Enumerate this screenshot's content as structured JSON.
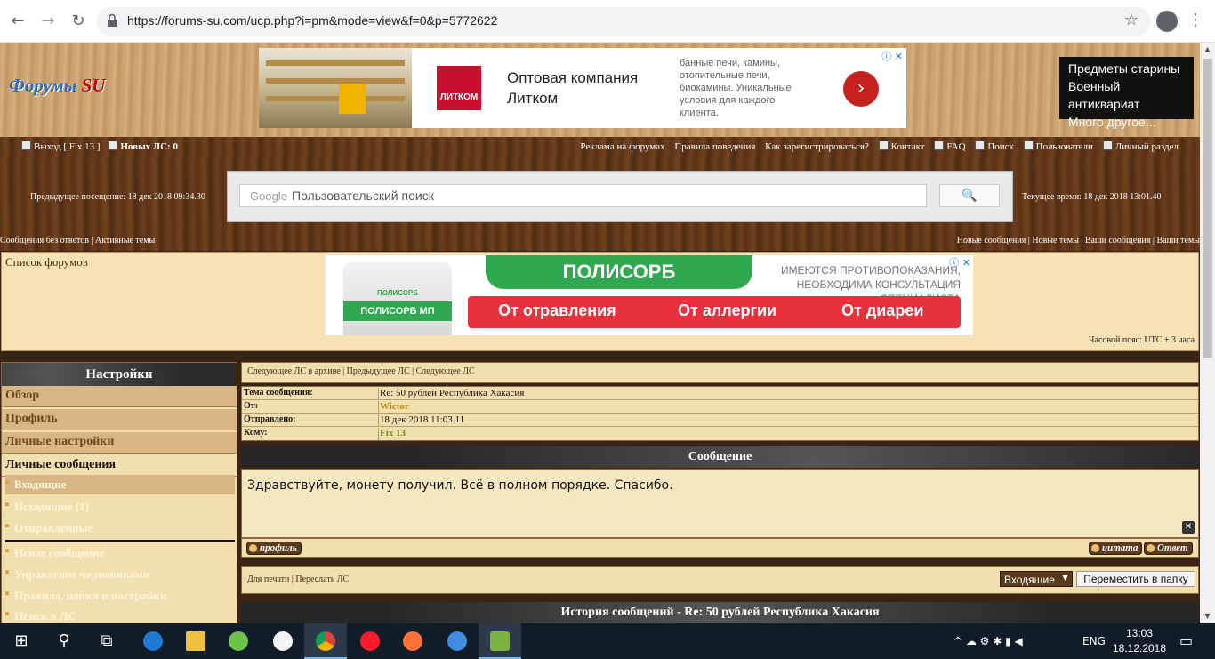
{
  "browser": {
    "url": "https://forums-su.com/ucp.php?i=pm&mode=view&f=0&p=5772622",
    "back_icon": "←",
    "forward_icon": "→",
    "reload_icon": "↻",
    "star_icon": "☆",
    "menu_icon": "⋮"
  },
  "site": {
    "logo_main": "Форумы ",
    "logo_su": "SU"
  },
  "ad_top": {
    "brand": "ЛИТКОМ",
    "title": "Оптовая компания Литком",
    "description": "банные печи, камины, отопительные печи, биокамины. Уникальные условия для каждого клиента.",
    "info_icon": "ⓘ ✕",
    "arrow": "›"
  },
  "ad_right": {
    "line1": "Предметы старины",
    "line2": "Военный антиквариат",
    "line3": "Много другое..."
  },
  "top_nav": {
    "logout": "Выход [ Fix 13 ]",
    "new_pm": "Новых ЛС: 0",
    "links": [
      "Реклама на форумах",
      "Правила поведения",
      "Как зарегистрироваться?"
    ],
    "icon_links": [
      "Контакт",
      "FAQ",
      "Поиск",
      "Пользователи",
      "Личный раздел"
    ]
  },
  "search": {
    "prev_visit": "Предыдущее посещение: 18 дек 2018 09:34.30",
    "google_label": "Google",
    "placeholder": "Пользовательский поиск",
    "button_icon": "🔍",
    "current_time": "Текущее время: 18 дек 2018 13:01.40"
  },
  "links_bar": {
    "left": [
      "Сообщения без ответов",
      "Активные темы"
    ],
    "right": [
      "Новые сообщения",
      "Новые темы",
      "Ваши сообщения",
      "Ваши темы"
    ]
  },
  "forum_list": {
    "breadcrumb": "Список форумов",
    "timezone": "Часовой пояс: UTC + 3 часа"
  },
  "ad_polisorb": {
    "brand": "ПОЛИСОРБ",
    "jar_label": "ПОЛИСОРБ МП",
    "jar_small": "ПОЛИСОРБ",
    "warning": "ИМЕЮТСЯ ПРОТИВОПОКАЗАНИЯ, НЕОБХОДИМА КОНСУЛЬТАЦИЯ СПЕЦИАЛИСТА",
    "points": [
      "От отравления",
      "От аллергии",
      "От диареи"
    ],
    "info_icon": "ⓘ ✕"
  },
  "sidebar": {
    "title": "Настройки",
    "tabs": [
      "Обзор",
      "Профиль",
      "Личные настройки",
      "Личные сообщения"
    ],
    "pm_items": [
      "Входящие",
      "Исходящие (1)",
      "Отправленные"
    ],
    "pm_actions": [
      "Новое сообщение",
      "Управление черновиками",
      "Правила, папки и настройки",
      "Поиск в ЛС"
    ]
  },
  "pm": {
    "nav": "Следующее ЛС в архиве | Предыдущее ЛС | Следующее ЛС",
    "rows": [
      {
        "key": "Тема сообщения:",
        "value": "Re: 50 рублей Республика Хакасия"
      },
      {
        "key": "От:",
        "value": "Wictor"
      },
      {
        "key": "Отправлено:",
        "value": "18 дек 2018 11:03.11"
      },
      {
        "key": "Кому:",
        "value": "Fix 13"
      }
    ],
    "message_header": "Сообщение",
    "message_text": "Здравствуйте, монету получил. Всё в полном порядке. Спасибо.",
    "close_icon": "✕",
    "profile_button": "профиль",
    "quote_button": "цитата",
    "reply_button": "Ответ",
    "actions_links": "Для печати | Переслать ЛС",
    "folder_select": "Входящие",
    "select_arrow": "▼",
    "move_button": "Переместить в папку",
    "history_header": "История сообщений - Re: 50 рублей Республика Хакасия"
  },
  "taskbar": {
    "start_icon": "⊞",
    "search_icon": "⚲",
    "taskview_icon": "⧉",
    "lang": "ENG",
    "time": "13:03",
    "date": "18.12.2018",
    "tray_icons": "^ ☁ ⚙ ✱ ▮ ◀"
  }
}
